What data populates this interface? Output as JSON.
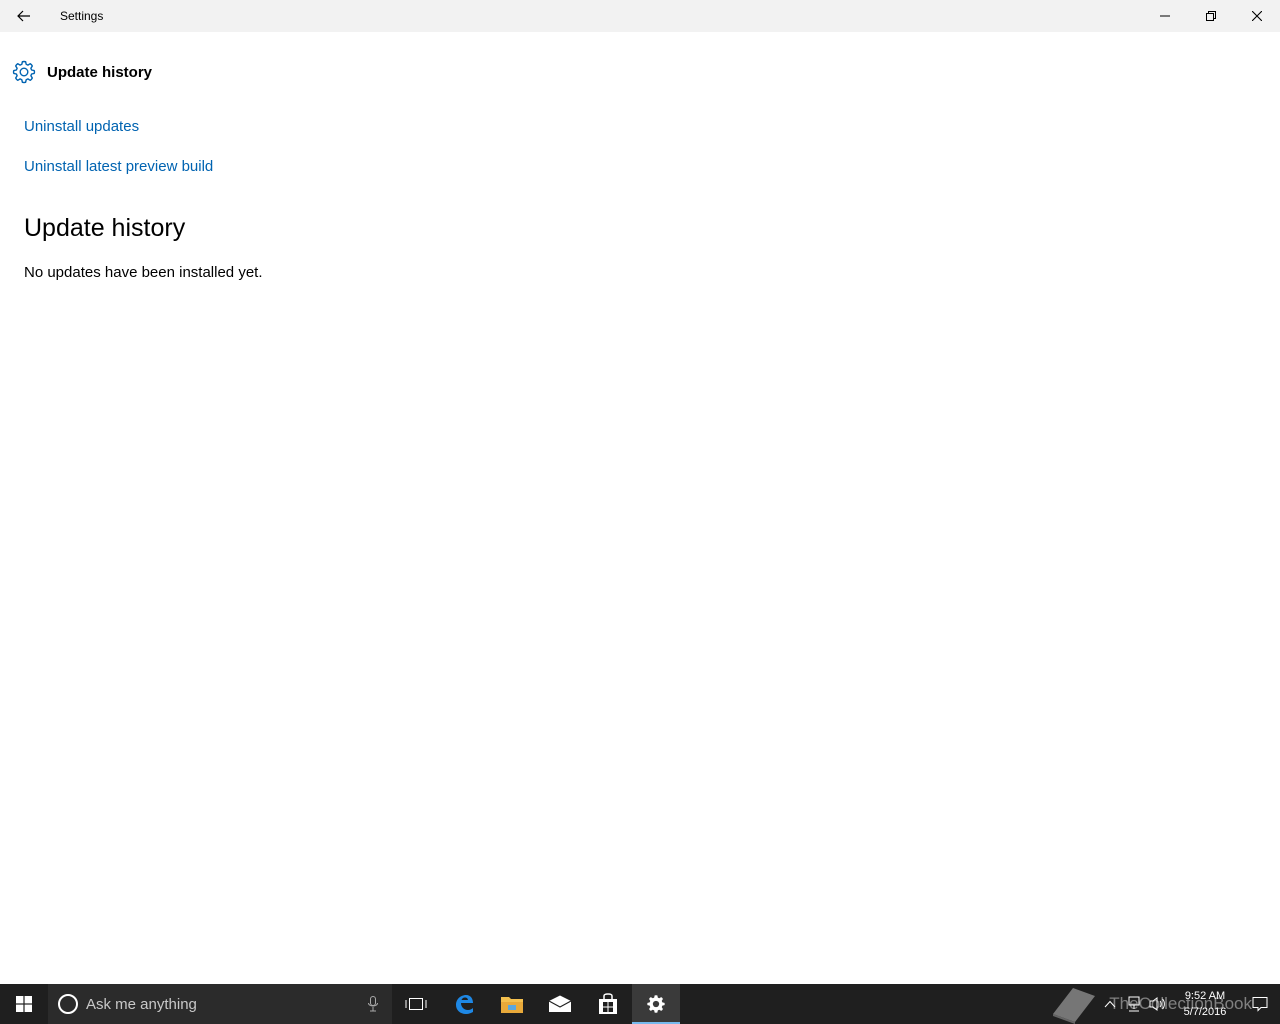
{
  "window": {
    "title": "Settings"
  },
  "page": {
    "header_title": "Update history",
    "links": {
      "uninstall_updates": "Uninstall updates",
      "uninstall_preview": "Uninstall latest preview build"
    },
    "section_title": "Update history",
    "empty_message": "No updates have been installed yet."
  },
  "taskbar": {
    "search_placeholder": "Ask me anything",
    "pinned": [
      "task-view-icon",
      "edge-icon",
      "file-explorer-icon",
      "mail-icon",
      "store-icon",
      "settings-icon"
    ],
    "active_app": "settings-icon",
    "clock_time": "9:52 AM",
    "clock_date": "5/7/2016",
    "watermark": "TheCollectionBook"
  },
  "colors": {
    "accent": "#0063b1",
    "taskbar_bg": "#1f1f1f",
    "titlebar_bg": "#f2f2f2"
  }
}
